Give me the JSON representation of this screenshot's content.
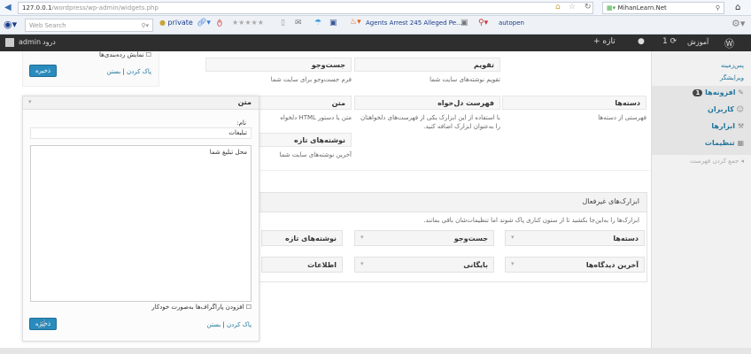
{
  "browser": {
    "url_host": "127.0.0.1",
    "url_path": "/wordpress/wp-admin/widgets.php",
    "search_engine": "MihanLearn.Net",
    "web_search_placeholder": "Web Search",
    "private_label": "private",
    "news_label": "Agents Arrest 245 Alleged Pe...",
    "autopen_label": "autopen"
  },
  "adminbar": {
    "user": "admin",
    "logout": "درود",
    "site": "آموزش",
    "updates": "1",
    "new": "تازه"
  },
  "menu": {
    "items": [
      {
        "label": "پس‌زمینه"
      },
      {
        "label": "ویرایشگر"
      },
      {
        "label": "افزونه‌ها",
        "badge": "1"
      },
      {
        "label": "کاربران"
      },
      {
        "label": "ابزارها"
      },
      {
        "label": "تنظیمات"
      },
      {
        "label": "جمع کردن فهرست"
      }
    ]
  },
  "available": {
    "widgets": [
      {
        "title": "تقویم",
        "desc": "تقویم نوشته‌های سایت شما"
      },
      {
        "title": "جست‌وجو",
        "desc": "فرم جست‌وجو برای سایت شما"
      },
      {
        "title": "دسته‌ها",
        "desc": "فهرستی از دسته‌ها"
      },
      {
        "title": "فهرست دل‌خواه",
        "desc": "با استفاده از این ابزارک یکی از فهرست‌های دلخواهتان را به‌عنوان ابزارک اضافه کنید."
      },
      {
        "title": "متن",
        "desc": "متن یا دستور HTML دلخواه"
      },
      {
        "title": "نوشته‌های تازه",
        "desc": "آخرین نوشته‌های سایت شما"
      }
    ]
  },
  "inactive": {
    "title": "ابزارک‌های غیرفعال",
    "desc": "ابزارک‌ها را به‌این‌جا بکشید تا از ستون کناری پاک شوند اما تنظیمات‌شان باقی بمانند.",
    "widgets": [
      "دسته‌ها",
      "جست‌وجو",
      "نوشته‌های تازه",
      "آخرین دیدگاه‌ها",
      "بایگانی",
      "اطلاعات"
    ]
  },
  "top_widget": {
    "checkbox_label": "نمایش رده‌بندی‌ها",
    "save": "ذخیره",
    "delete": "پاک کردن",
    "close": "بستن"
  },
  "text_widget": {
    "header": "متن",
    "title_label": "نام:",
    "title_value": "تبلیغات",
    "content": "محل تبلیغ شما",
    "autop_label": "افزودن پاراگراف‌ها به‌صورت خودکار",
    "save": "ذخیره",
    "delete": "پاک کردن",
    "close": "بستن"
  }
}
